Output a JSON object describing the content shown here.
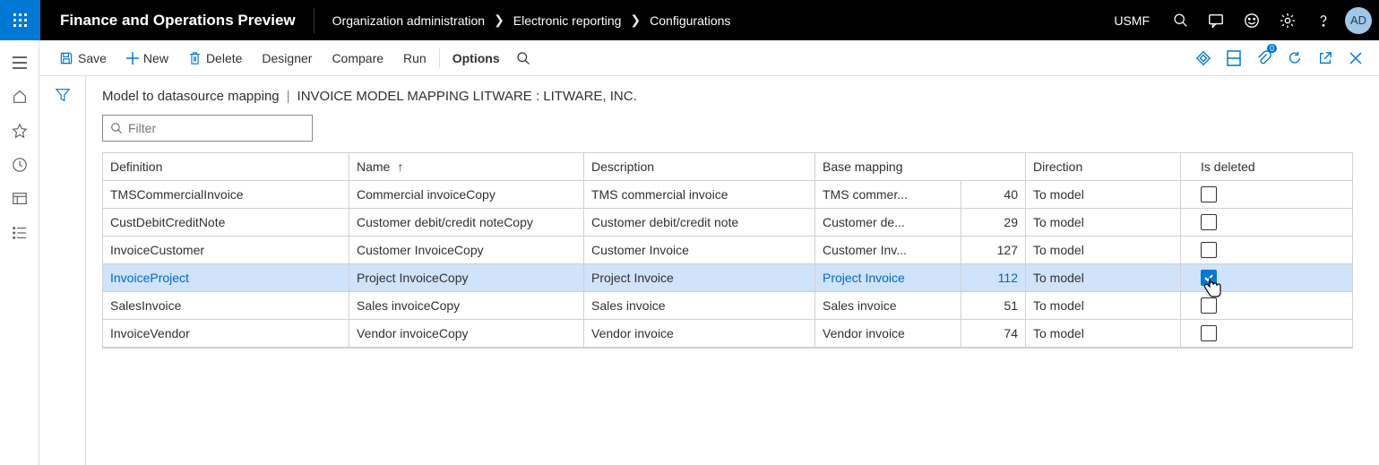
{
  "top": {
    "app_title": "Finance and Operations Preview",
    "breadcrumb": [
      "Organization administration",
      "Electronic reporting",
      "Configurations"
    ],
    "company": "USMF",
    "avatar": "AD"
  },
  "actions": {
    "save": "Save",
    "new": "New",
    "delete": "Delete",
    "designer": "Designer",
    "compare": "Compare",
    "run": "Run",
    "options": "Options"
  },
  "page": {
    "title_primary": "Model to datasource mapping",
    "title_secondary": "INVOICE MODEL MAPPING LITWARE : LITWARE, INC.",
    "filter_placeholder": "Filter"
  },
  "grid": {
    "columns": {
      "definition": "Definition",
      "name": "Name",
      "description": "Description",
      "base_mapping": "Base mapping",
      "direction": "Direction",
      "is_deleted": "Is deleted"
    },
    "sort_arrow": "↑",
    "rows": [
      {
        "definition": "TMSCommercialInvoice",
        "name": "Commercial invoiceCopy",
        "description": "TMS commercial invoice",
        "base": "TMS commer...",
        "basen": "40",
        "direction": "To model",
        "deleted": false,
        "selected": false
      },
      {
        "definition": "CustDebitCreditNote",
        "name": "Customer debit/credit noteCopy",
        "description": "Customer debit/credit note",
        "base": "Customer de...",
        "basen": "29",
        "direction": "To model",
        "deleted": false,
        "selected": false
      },
      {
        "definition": "InvoiceCustomer",
        "name": "Customer InvoiceCopy",
        "description": "Customer Invoice",
        "base": "Customer Inv...",
        "basen": "127",
        "direction": "To model",
        "deleted": false,
        "selected": false
      },
      {
        "definition": "InvoiceProject",
        "name": "Project InvoiceCopy",
        "description": "Project Invoice",
        "base": "Project Invoice",
        "basen": "112",
        "direction": "To model",
        "deleted": true,
        "selected": true
      },
      {
        "definition": "SalesInvoice",
        "name": "Sales invoiceCopy",
        "description": "Sales invoice",
        "base": "Sales invoice",
        "basen": "51",
        "direction": "To model",
        "deleted": false,
        "selected": false
      },
      {
        "definition": "InvoiceVendor",
        "name": "Vendor invoiceCopy",
        "description": "Vendor invoice",
        "base": "Vendor invoice",
        "basen": "74",
        "direction": "To model",
        "deleted": false,
        "selected": false
      }
    ]
  }
}
